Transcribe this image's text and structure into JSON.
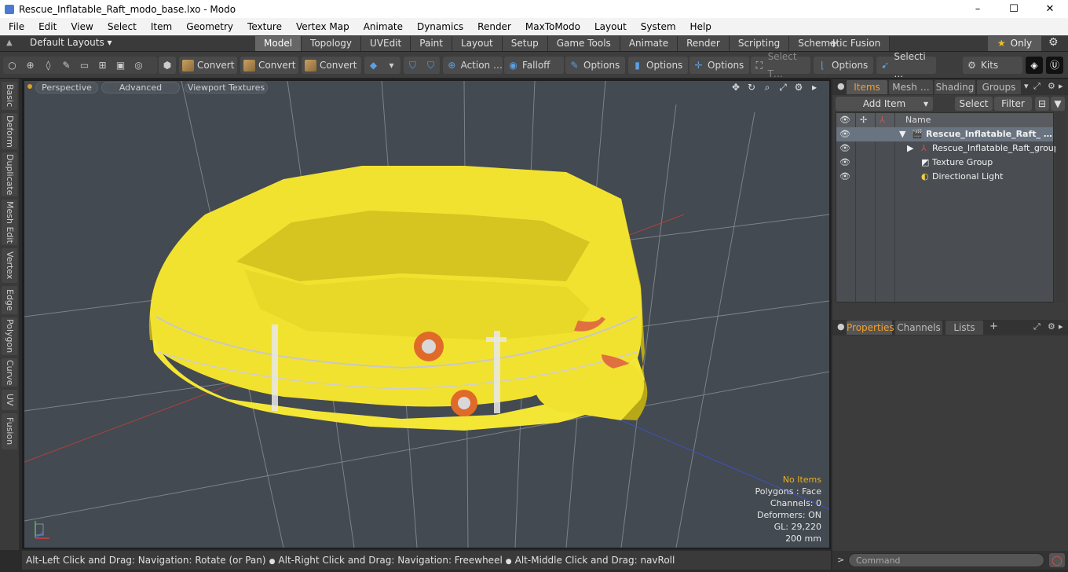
{
  "window": {
    "title": "Rescue_Inflatable_Raft_modo_base.lxo - Modo",
    "minimize": "–",
    "maximize": "☐",
    "close": "✕"
  },
  "menu": [
    "File",
    "Edit",
    "View",
    "Select",
    "Item",
    "Geometry",
    "Texture",
    "Vertex Map",
    "Animate",
    "Dynamics",
    "Render",
    "MaxToModo",
    "Layout",
    "System",
    "Help"
  ],
  "layoutbar": {
    "layout_selector": "Default Layouts ▾",
    "tabs": [
      "Model",
      "Topology",
      "UVEdit",
      "Paint",
      "Layout",
      "Setup",
      "Game Tools",
      "Animate",
      "Render",
      "Scripting",
      "Schematic Fusion"
    ],
    "active_tab": "Model",
    "plus": "+",
    "only": "Only",
    "star": "★",
    "gear": "⚙"
  },
  "toolbar": {
    "convert1": "Convert",
    "convert2": "Convert",
    "convert3": "Convert",
    "action": "Action",
    "action_more": "…",
    "falloff": "Falloff",
    "options1": "Options",
    "options2": "Options",
    "options3": "Options",
    "options4": "Options",
    "select_t": "Select T…",
    "selecti": "Selecti …",
    "kits": "Kits"
  },
  "left_tabs": [
    "Basic",
    "Deform",
    "Duplicate",
    "Mesh Edit",
    "Vertex",
    "Edge",
    "Polygon",
    "Curve",
    "UV",
    "Fusion"
  ],
  "viewport": {
    "perspective": "Perspective",
    "advanced": "Advanced",
    "textures": "Viewport Textures",
    "info": {
      "no_items": "No Items",
      "polygons": "Polygons : Face",
      "channels": "Channels: 0",
      "deformers": "Deformers: ON",
      "gl": "GL: 29,220",
      "scale": "200 mm"
    },
    "colors": {
      "raft": "#f2e230",
      "raft_shadow": "#b8a818",
      "bg": "#434a51",
      "grid": "#7c8288"
    }
  },
  "status": {
    "hint1": "Alt-Left Click and Drag: Navigation: Rotate (or Pan)",
    "hint2": "Alt-Right Click and Drag: Navigation: Freewheel",
    "hint3": "Alt-Middle Click and Drag: navRoll"
  },
  "panel": {
    "tabs": [
      "Items",
      "Mesh …",
      "Shading",
      "Groups"
    ],
    "add_item": "Add Item",
    "select": "Select",
    "filter": "Filter",
    "name_col": "Name",
    "tree": [
      {
        "label": "Rescue_Inflatable_Raft_ …",
        "bold": true
      },
      {
        "label": "Rescue_Inflatable_Raft_group"
      },
      {
        "label": "Texture Group"
      },
      {
        "label": "Directional Light"
      }
    ],
    "bottom_tabs": [
      "Properties",
      "Channels",
      "Lists"
    ],
    "bottom_plus": "+"
  },
  "command": {
    "placeholder": "Command"
  }
}
